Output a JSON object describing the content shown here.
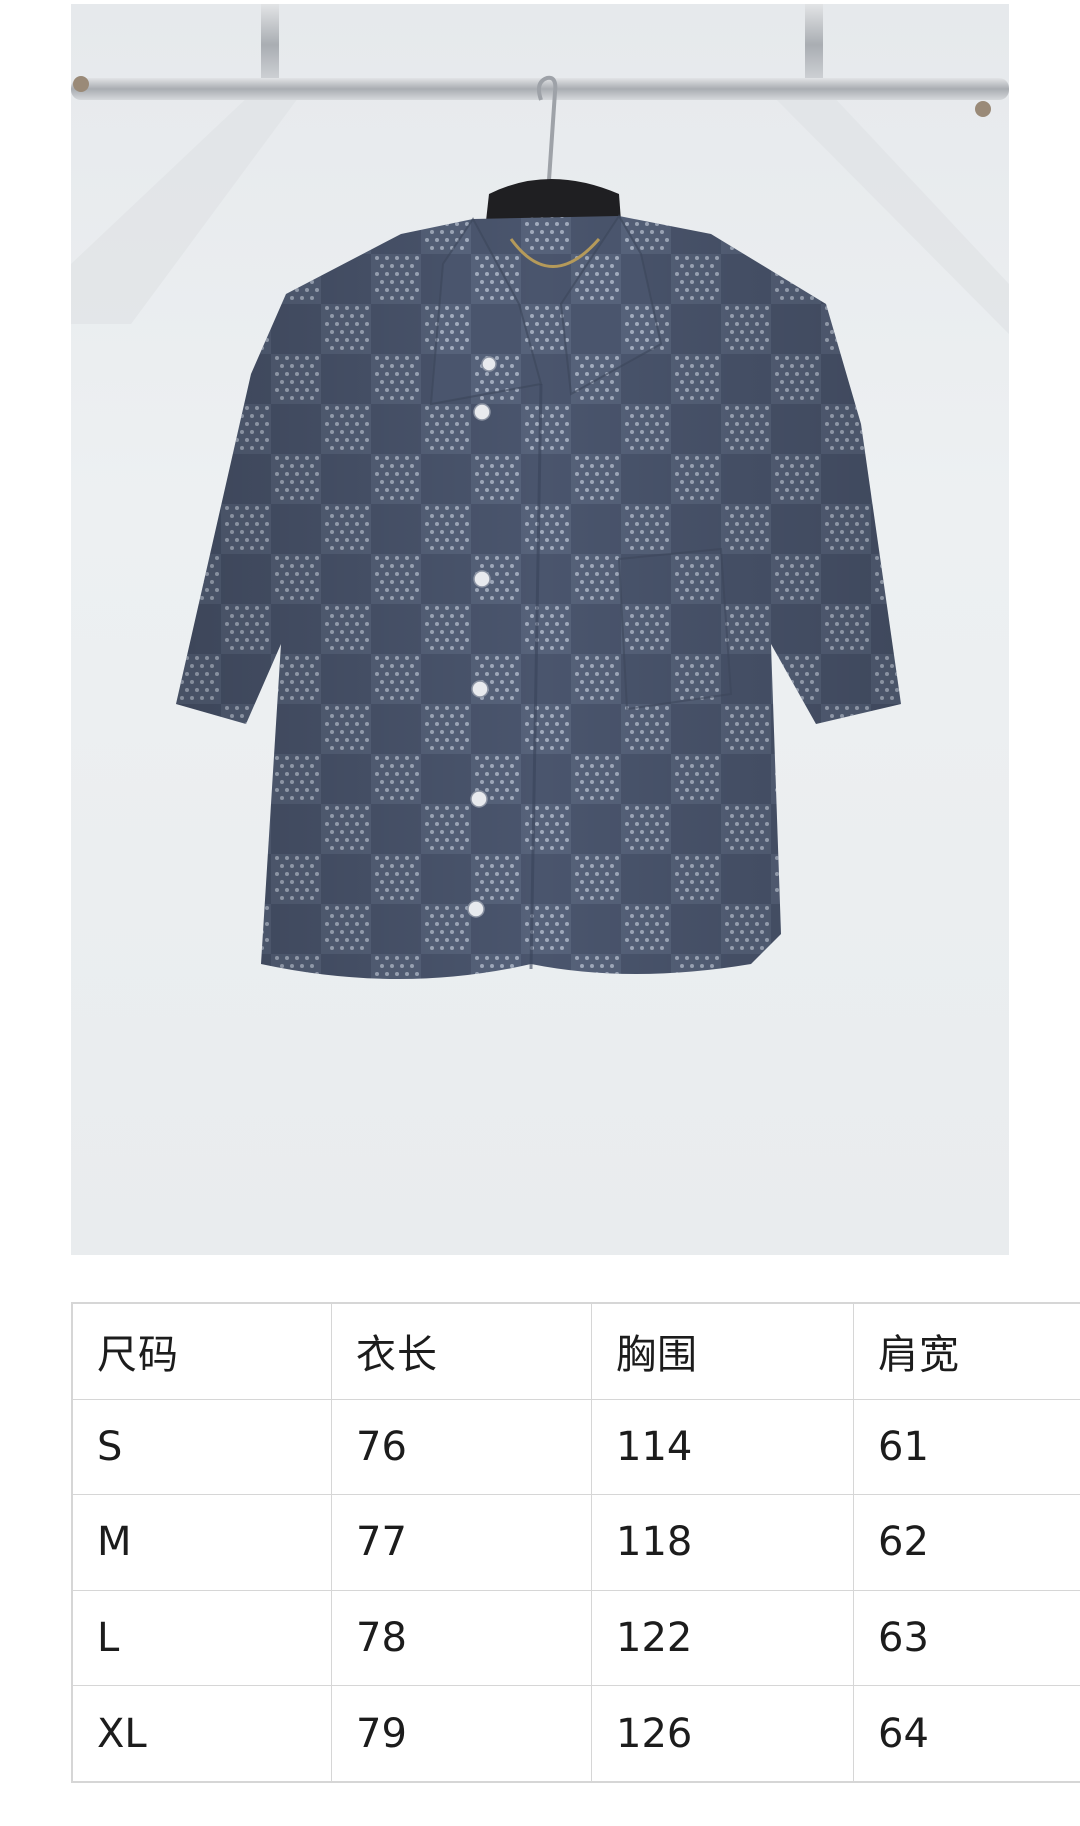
{
  "product_photo": {
    "description_icon": "shirt-on-hanger-photo",
    "colors": {
      "background": "#e9ecee",
      "shirt_base": "#4f5b73",
      "shirt_light_dots": "#a9b3c4",
      "rail": "#b9bcc0"
    }
  },
  "size_chart": {
    "headers": [
      "尺码",
      "衣长",
      "胸围",
      "肩宽"
    ],
    "rows": [
      [
        "S",
        "76",
        "114",
        "61"
      ],
      [
        "M",
        "77",
        "118",
        "62"
      ],
      [
        "L",
        "78",
        "122",
        "63"
      ],
      [
        "XL",
        "79",
        "126",
        "64"
      ]
    ]
  }
}
